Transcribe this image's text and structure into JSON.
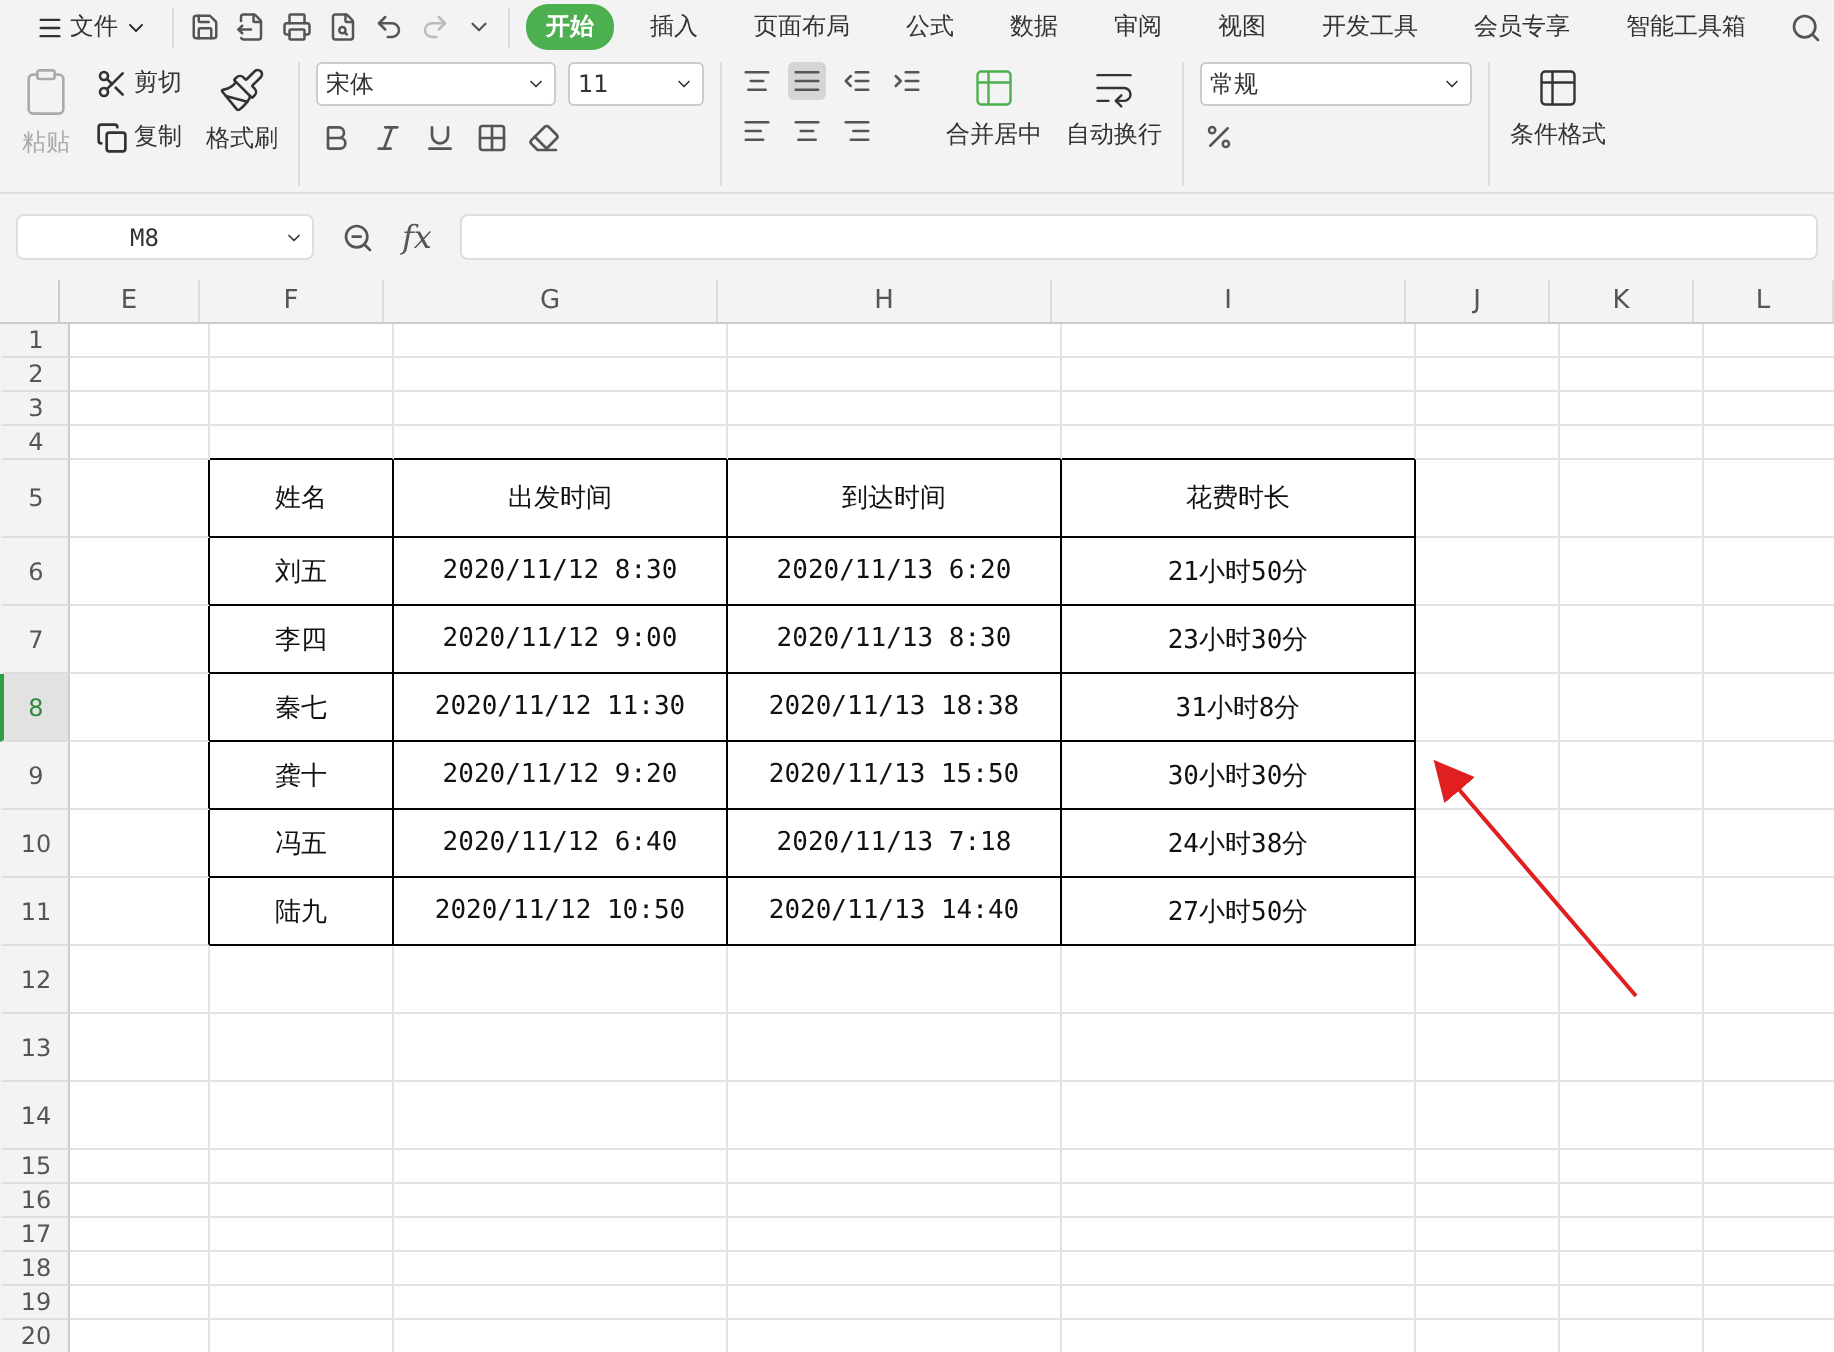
{
  "menu": {
    "file_label": "文件",
    "tabs": [
      {
        "label": "开始",
        "selected": true
      },
      {
        "label": "插入",
        "selected": false
      },
      {
        "label": "页面布局",
        "selected": false
      },
      {
        "label": "公式",
        "selected": false
      },
      {
        "label": "数据",
        "selected": false
      },
      {
        "label": "审阅",
        "selected": false
      },
      {
        "label": "视图",
        "selected": false
      },
      {
        "label": "开发工具",
        "selected": false
      },
      {
        "label": "会员专享",
        "selected": false
      },
      {
        "label": "智能工具箱",
        "selected": false
      }
    ]
  },
  "ribbon": {
    "paste": {
      "label": "粘贴",
      "disabled": true
    },
    "cut": "剪切",
    "copy": "复制",
    "format_painter": "格式刷",
    "font": "宋体",
    "font_size": "11",
    "align_middle_selected": true,
    "merge": "合并居中",
    "wrap": "自动换行",
    "number_format": "常规",
    "conditional_format": "条件格式"
  },
  "formula_bar": {
    "name_box": "M8",
    "fx": "fx"
  },
  "sheet": {
    "columns": [
      "E",
      "F",
      "G",
      "H",
      "I",
      "J",
      "K",
      "L"
    ],
    "rows": [
      {
        "label": "1",
        "selected": false
      },
      {
        "label": "2",
        "selected": false
      },
      {
        "label": "3",
        "selected": false
      },
      {
        "label": "4",
        "selected": false
      },
      {
        "label": "5",
        "selected": false
      },
      {
        "label": "6",
        "selected": false
      },
      {
        "label": "7",
        "selected": false
      },
      {
        "label": "8",
        "selected": true
      },
      {
        "label": "9",
        "selected": false
      },
      {
        "label": "10",
        "selected": false
      },
      {
        "label": "11",
        "selected": false
      },
      {
        "label": "12",
        "selected": false
      },
      {
        "label": "13",
        "selected": false
      },
      {
        "label": "14",
        "selected": false
      },
      {
        "label": "15",
        "selected": false
      },
      {
        "label": "16",
        "selected": false
      },
      {
        "label": "17",
        "selected": false
      },
      {
        "label": "18",
        "selected": false
      },
      {
        "label": "19",
        "selected": false
      },
      {
        "label": "20",
        "selected": false
      }
    ]
  },
  "table": {
    "header": [
      "姓名",
      "出发时间",
      "到达时间",
      "花费时长"
    ],
    "rows": [
      [
        "刘五",
        "2020/11/12 8:30",
        "2020/11/13 6:20",
        "21小时50分"
      ],
      [
        "李四",
        "2020/11/12 9:00",
        "2020/11/13 8:30",
        "23小时30分"
      ],
      [
        "秦七",
        "2020/11/12 11:30",
        "2020/11/13 18:38",
        "31小时8分"
      ],
      [
        "龚十",
        "2020/11/12 9:20",
        "2020/11/13 15:50",
        "30小时30分"
      ],
      [
        "冯五",
        "2020/11/12 6:40",
        "2020/11/13 7:18",
        "24小时38分"
      ],
      [
        "陆九",
        "2020/11/12 10:50",
        "2020/11/13 14:40",
        "27小时50分"
      ]
    ]
  },
  "annotation": {
    "kind": "arrow"
  }
}
